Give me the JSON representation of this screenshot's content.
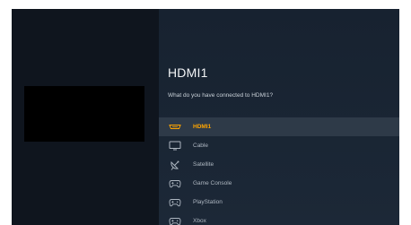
{
  "title": "HDMI1",
  "subtitle": "What do you have connected to HDMI1?",
  "options": [
    {
      "label": "HDMI1",
      "icon": "hdmi-icon",
      "selected": true
    },
    {
      "label": "Cable",
      "icon": "tv-icon",
      "selected": false
    },
    {
      "label": "Satellite",
      "icon": "satellite-icon",
      "selected": false
    },
    {
      "label": "Game Console",
      "icon": "gamepad-icon",
      "selected": false
    },
    {
      "label": "PlayStation",
      "icon": "gamepad-icon",
      "selected": false
    },
    {
      "label": "Xbox",
      "icon": "gamepad-icon",
      "selected": false
    }
  ],
  "colors": {
    "accent": "#ffa500",
    "background": "#172230",
    "selected_row": "#2e3a48",
    "text_muted": "#aeb7c1"
  }
}
